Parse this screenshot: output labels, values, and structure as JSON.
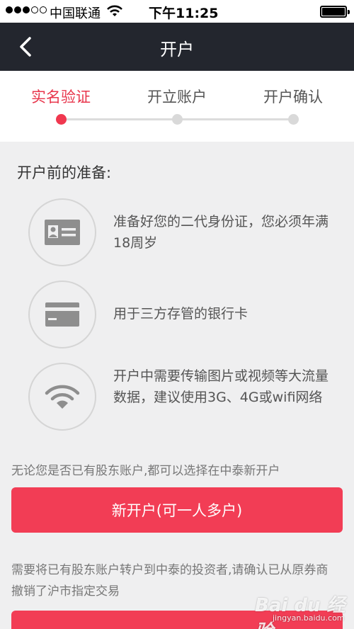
{
  "status_bar": {
    "carrier": "中国联通",
    "time": "下午11:25"
  },
  "nav": {
    "title": "开户"
  },
  "steps": [
    {
      "label": "实名验证",
      "active": true
    },
    {
      "label": "开立账户",
      "active": false
    },
    {
      "label": "开户确认",
      "active": false
    }
  ],
  "preparation": {
    "title": "开户前的准备:",
    "items": [
      {
        "icon": "id-card-icon",
        "text": "准备好您的二代身份证，您必须年满18周岁"
      },
      {
        "icon": "bank-card-icon",
        "text": "用于三方存管的银行卡"
      },
      {
        "icon": "wifi-icon",
        "text": "开户中需要传输图片或视频等大流量数据，建议使用3G、4G或wifi网络"
      }
    ]
  },
  "new_account": {
    "note": "无论您是否已有股东账户,都可以选择在中泰新开户",
    "button_label": "新开户(可一人多户)"
  },
  "transfer": {
    "note": "需要将已有股东账户转户到中泰的投资者,请确认已从原券商撤销了沪市指定交易"
  },
  "watermark": {
    "brand": "Bai du 经验",
    "url": "jingyan.baidu.com"
  },
  "colors": {
    "accent": "#f23d55",
    "nav_bg": "#23262e",
    "page_bg": "#efeff0"
  }
}
